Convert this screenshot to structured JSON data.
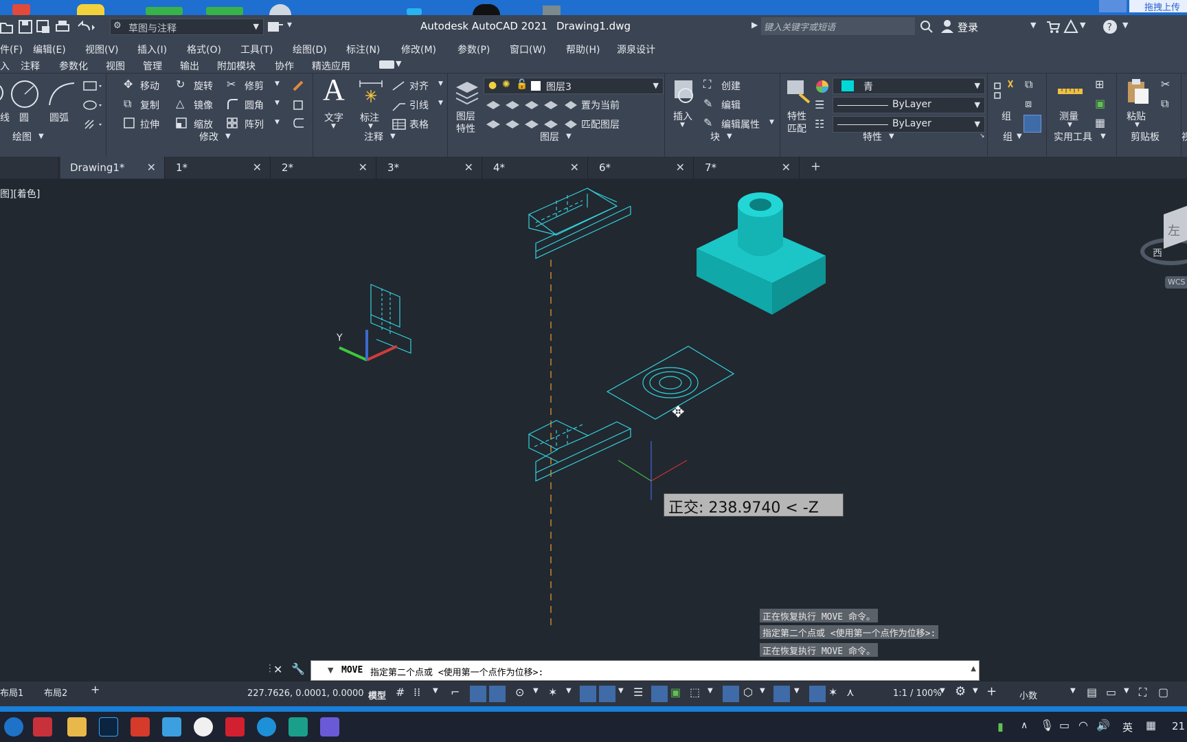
{
  "window": {
    "title": "Autodesk AutoCAD 2021",
    "filename": "Drawing1.dwg"
  },
  "qat": {
    "workspace": "草图与注释",
    "search_placeholder": "键入关键字或短语",
    "login": "登录",
    "top_right_text": "拖拽上传"
  },
  "menubar": {
    "items": [
      "件(F)",
      "编辑(E)",
      "视图(V)",
      "插入(I)",
      "格式(O)",
      "工具(T)",
      "绘图(D)",
      "标注(N)",
      "修改(M)",
      "参数(P)",
      "窗口(W)",
      "帮助(H)",
      "源泉设计"
    ]
  },
  "ribbon_tabs": {
    "items": [
      "入",
      "注释",
      "参数化",
      "视图",
      "管理",
      "输出",
      "附加模块",
      "协作",
      "精选应用"
    ]
  },
  "ribbon": {
    "draw": {
      "title": "绘图",
      "line": "线",
      "circle": "圆",
      "arc": "圆弧"
    },
    "modify": {
      "title": "修改",
      "move": "移动",
      "rotate": "旋转",
      "trim": "修剪",
      "copy": "复制",
      "mirror": "镜像",
      "fillet": "圆角",
      "stretch": "拉伸",
      "scale": "缩放",
      "array": "阵列"
    },
    "annotation": {
      "title": "注释",
      "text": "文字",
      "dimension": "标注",
      "align": "对齐",
      "leader": "引线",
      "table": "表格"
    },
    "layers": {
      "title": "图层",
      "properties_1": "图层",
      "properties_2": "特性",
      "current_layer": "图层3",
      "set_current": "置为当前",
      "match_layer": "匹配图层"
    },
    "block": {
      "title": "块",
      "insert": "插入",
      "create": "创建",
      "edit": "编辑",
      "edit_attributes": "编辑属性"
    },
    "properties": {
      "title": "特性",
      "match_1": "特性",
      "match_2": "匹配",
      "color": "青",
      "color_hex": "#00d8d8",
      "linetype": "ByLayer",
      "lineweight": "ByLayer"
    },
    "group": {
      "title": "组",
      "label": "组"
    },
    "utilities": {
      "title": "实用工具",
      "measure": "测量"
    },
    "clipboard": {
      "title": "剪贴板",
      "paste": "粘贴"
    },
    "extra_title": "视"
  },
  "doctabs": [
    {
      "label": "Drawing1*",
      "active": true
    },
    {
      "label": "1*",
      "active": false
    },
    {
      "label": "2*",
      "active": false
    },
    {
      "label": "3*",
      "active": false
    },
    {
      "label": "4*",
      "active": false
    },
    {
      "label": "6*",
      "active": false
    },
    {
      "label": "7*",
      "active": false
    }
  ],
  "viewport": {
    "label": "图][着色]",
    "tooltip": "正交: 238.9740 < -Z",
    "viewcube_face": "左",
    "viewcube_compass": "西",
    "wcs": "WCS",
    "ucs_y": "Y"
  },
  "command": {
    "history": [
      "正在恢复执行 MOVE 命令。",
      "指定第二个点或 <使用第一个点作为位移>:",
      "正在恢复执行 MOVE 命令。"
    ],
    "current_cmd": "MOVE",
    "prompt": "指定第二个点或 <使用第一个点作为位移>:"
  },
  "layout_tabs": [
    "布局1",
    "布局2"
  ],
  "statusbar": {
    "coords": "227.7626, 0.0001, 0.0000",
    "model": "模型",
    "scale": "1:1 / 100%",
    "units": "小数"
  },
  "taskbar": {
    "lang": "英",
    "time": "21"
  }
}
